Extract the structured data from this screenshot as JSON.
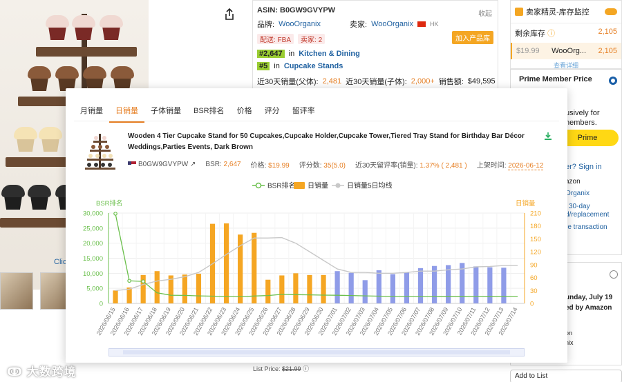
{
  "background": {
    "click_text": "Click",
    "asin_panel": {
      "asin": "ASIN: B0GW9GVYPW",
      "collapse": "收起",
      "brand_label": "品牌:",
      "brand": "WooOrganix",
      "seller_label": "卖家:",
      "seller": "WooOrganix",
      "seller_country": "HK",
      "fba_tag": "配送: FBA",
      "sellers_tag": "卖家: 2",
      "add_pool": "加入产品库",
      "rank1_num": "#2,647",
      "rank1_in": "in",
      "rank1_cat": "Kitchen & Dining",
      "rank2_num": "#5",
      "rank2_in": "in",
      "rank2_cat": "Cupcake Stands",
      "sales_parent_label": "近30天销量(父体):",
      "sales_parent": "2,481",
      "sales_child_label": "近30天销量(子体):",
      "sales_child": "2,000+",
      "revenue_label": "销售额:",
      "revenue": "$49,595"
    },
    "right_col": {
      "monitor_title": "卖家精灵-库存监控",
      "stock_label": "剩余库存",
      "stock_value": "2,105",
      "row_price": "$19.99",
      "row_seller": "WooOrg...",
      "row_stock": "2,105",
      "more": "查看详细",
      "prime_title": "Prime Member Price",
      "prime_l1": "usively for",
      "prime_l2": "nembers.",
      "prime_btn": "Prime",
      "signin": "er? Sign in",
      "t1": "azon",
      "t2": "Organix",
      "t3": "30-day",
      "t4": "d/replacement",
      "t5": "re transaction",
      "t6": "unday, July 19",
      "t7": "ed by Amazon",
      "t8": "on",
      "t9": "nix",
      "add_list": "Add to List"
    },
    "list_price_label": "List Price:",
    "list_price": "$21.99",
    "watermark": "大数跨境"
  },
  "popup": {
    "tabs": [
      "月销量",
      "日销量",
      "子体销量",
      "BSR排名",
      "价格",
      "评分",
      "留评率"
    ],
    "active_tab": 1,
    "product_title": "Wooden 4 Tier Cupcake Stand for 50 Cupcakes,Cupcake Holder,Cupcake Tower,Tiered Tray Stand for Birthday Bar Décor Weddings,Parties Events, Dark Brown",
    "asin": "B0GW9GVYPW",
    "bsr_label": "BSR:",
    "bsr": "2,647",
    "price_label": "价格:",
    "price": "$19.99",
    "rating_label": "评分数:",
    "rating": "35(5.0)",
    "review_rate_label": "近30天留评率(销量):",
    "review_rate": "1.37% ( 2,481 )",
    "launch_label": "上架时间:",
    "launch": "2026-06-12"
  },
  "chart_data": {
    "type": "bar",
    "legend": [
      "BSR排名",
      "日销量",
      "日销量5日均线"
    ],
    "left_axis_title": "BSR排名",
    "right_axis_title": "日销量",
    "left_ylim": [
      0,
      30000
    ],
    "left_ticks": [
      "0",
      "5,000",
      "10,000",
      "15,000",
      "20,000",
      "25,000",
      "30,000"
    ],
    "right_ylim": [
      0,
      210
    ],
    "right_ticks": [
      "0",
      "30",
      "60",
      "90",
      "120",
      "150",
      "180",
      "210"
    ],
    "x": [
      "2026/06/15",
      "2026/06/16",
      "2026/06/17",
      "2026/06/18",
      "2026/06/19",
      "2026/06/20",
      "2026/06/21",
      "2026/06/22",
      "2026/06/23",
      "2026/06/24",
      "2026/06/25",
      "2026/06/26",
      "2026/06/27",
      "2026/06/28",
      "2026/06/29",
      "2026/06/30",
      "2026/07/01",
      "2026/07/02",
      "2026/07/03",
      "2026/07/04",
      "2026/07/05",
      "2026/07/06",
      "2026/07/07",
      "2026/07/08",
      "2026/07/09",
      "2026/07/10",
      "2026/07/11",
      "2026/07/12",
      "2026/07/13",
      "2026/07/14"
    ],
    "series": [
      {
        "name": "日销量",
        "values": [
          30,
          37,
          66,
          75,
          65,
          67,
          69,
          185,
          186,
          160,
          164,
          55,
          65,
          70,
          66,
          66,
          75,
          71,
          54,
          77,
          68,
          72,
          82,
          87,
          89,
          94,
          86,
          84,
          83,
          null
        ]
      },
      {
        "name": "BSR排名",
        "values": [
          29800,
          7500,
          7300,
          3500,
          2700,
          2650,
          2500,
          2400,
          2300,
          2200,
          2450,
          2600,
          3000,
          2900,
          2850,
          2750,
          2700,
          2600,
          2500,
          2400,
          2300,
          2300,
          2200,
          2200,
          2250,
          2250,
          2300,
          2250,
          2300,
          2300
        ]
      },
      {
        "name": "日销量5日均线",
        "values": [
          30,
          33,
          44,
          52,
          56,
          62,
          72,
          92,
          114,
          134,
          152,
          152,
          153,
          140,
          120,
          100,
          80,
          72,
          72,
          70,
          70,
          72,
          75,
          75,
          78,
          80,
          85,
          86,
          88,
          88
        ]
      }
    ],
    "colors": {
      "bsr": "#6abf4b",
      "sales_orange": "#f5a623",
      "sales_blue": "#8f9ce8",
      "ma": "#c8c8c8",
      "axis_left": "#6abf4b",
      "axis_right": "#f5a623"
    },
    "grid": true,
    "legend_position": "top-center"
  }
}
